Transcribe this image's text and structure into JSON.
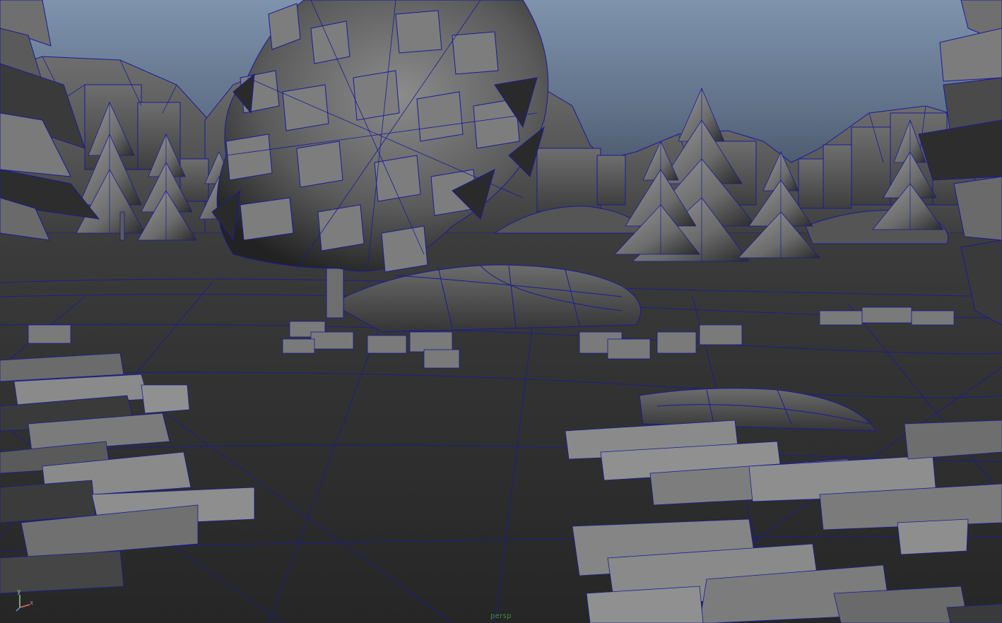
{
  "viewport": {
    "camera_name": "persp",
    "display_mode": "wireframe-on-shaded",
    "wire_color": "#1a1a9c",
    "sky_top_color": "#7f93ad",
    "sky_horizon_color": "#3b4655",
    "ground_color": "#2e2e2e",
    "foliage_light_color": "#8a8a8a",
    "foliage_dark_color": "#2f2f2f"
  },
  "axis": {
    "y_label": "y",
    "x_label": "x",
    "y_color": "#8fd18f",
    "x_color": "#e07070",
    "z_color": "#6f8fe0"
  }
}
